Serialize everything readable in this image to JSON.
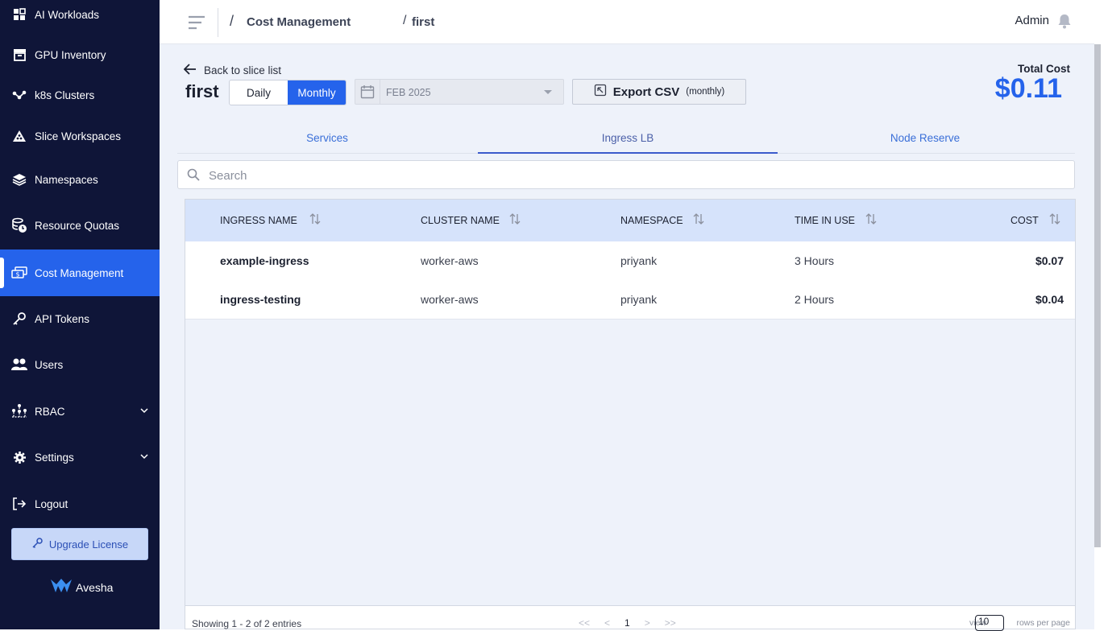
{
  "sidebar": {
    "items": [
      {
        "label": "AI Workloads",
        "icon": "grid-icon"
      },
      {
        "label": "GPU Inventory",
        "icon": "archive-icon"
      },
      {
        "label": "k8s Clusters",
        "icon": "nodes-icon"
      },
      {
        "label": "Slice Workspaces",
        "icon": "slice-icon"
      },
      {
        "label": "Namespaces",
        "icon": "layers-icon"
      },
      {
        "label": "Resource Quotas",
        "icon": "coins-clock-icon"
      },
      {
        "label": "Cost Management",
        "icon": "money-icon",
        "active": true
      },
      {
        "label": "API Tokens",
        "icon": "key-icon"
      },
      {
        "label": "Users",
        "icon": "users-icon"
      },
      {
        "label": "RBAC",
        "icon": "rbac-icon"
      },
      {
        "label": "Settings",
        "icon": "gear-icon"
      },
      {
        "label": "Logout",
        "icon": "logout-icon"
      }
    ],
    "upgrade_label": "Upgrade License",
    "brand": "Avesha"
  },
  "header": {
    "breadcrumb": [
      "Cost Management",
      "first"
    ],
    "user": "Admin"
  },
  "page": {
    "back_label": "Back to slice list",
    "title": "first",
    "toggle": {
      "daily": "Daily",
      "monthly": "Monthly",
      "selected": "Monthly"
    },
    "date_value": "FEB 2025",
    "export_label": "Export CSV",
    "export_sub": "(monthly)",
    "total_cost_label": "Total Cost",
    "total_cost_value": "$0.11"
  },
  "tabs": [
    {
      "label": "Services"
    },
    {
      "label": "Ingress LB",
      "selected": true
    },
    {
      "label": "Node Reserve"
    }
  ],
  "search": {
    "placeholder": "Search"
  },
  "table": {
    "columns": [
      "INGRESS NAME",
      "CLUSTER NAME",
      "NAMESPACE",
      "TIME IN USE",
      "COST"
    ],
    "rows": [
      {
        "ingress": "example-ingress",
        "cluster": "worker-aws",
        "namespace": "priyank",
        "time": "3 Hours",
        "cost": "$0.07"
      },
      {
        "ingress": "ingress-testing",
        "cluster": "worker-aws",
        "namespace": "priyank",
        "time": "2 Hours",
        "cost": "$0.04"
      }
    ]
  },
  "footer": {
    "info": "Showing 1 - 2 of 2 entries",
    "first": "<<",
    "prev": "<",
    "page": "1",
    "next": ">",
    "last": ">>",
    "view_label": "view",
    "rows_value": "10",
    "rows_label": "rows per page"
  },
  "colors": {
    "sidebar_bg": "#0f1538",
    "accent": "#2563eb",
    "header_row": "#d6e3fb"
  }
}
